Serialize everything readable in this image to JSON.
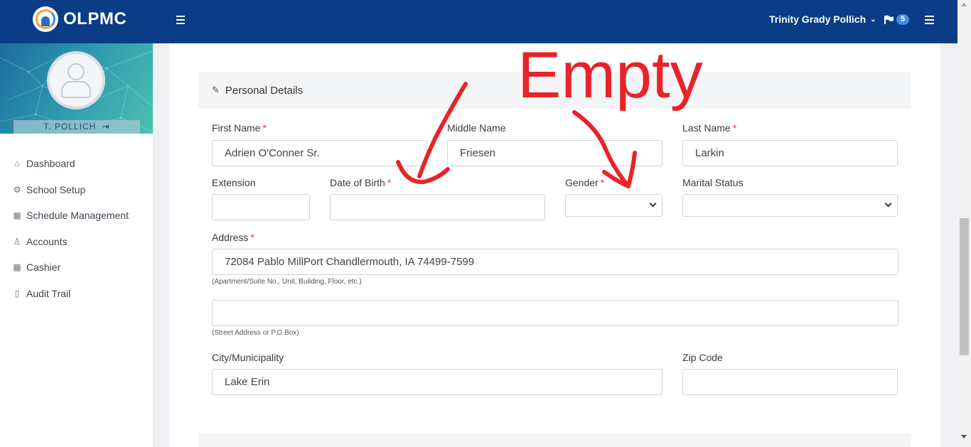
{
  "app": {
    "brand": "OLPMC"
  },
  "header": {
    "user_name": "Trinity Grady Pollich",
    "notification_count": "5"
  },
  "sidebar": {
    "profile_name": "T. POLLICH",
    "items": [
      {
        "label": "Dashboard",
        "icon": "home-icon"
      },
      {
        "label": "School Setup",
        "icon": "gear-icon"
      },
      {
        "label": "Schedule Management",
        "icon": "calendar-icon"
      },
      {
        "label": "Accounts",
        "icon": "users-icon"
      },
      {
        "label": "Cashier",
        "icon": "calculator-icon"
      },
      {
        "label": "Audit Trail",
        "icon": "book-icon"
      }
    ]
  },
  "form": {
    "section_title": "Personal Details",
    "required_mark": "*",
    "first_name": {
      "label": "First Name",
      "value": "Adrien O'Conner Sr."
    },
    "middle_name": {
      "label": "Middle Name",
      "value": "Friesen"
    },
    "last_name": {
      "label": "Last Name",
      "value": "Larkin"
    },
    "extension": {
      "label": "Extension",
      "value": ""
    },
    "date_of_birth": {
      "label": "Date of Birth",
      "value": ""
    },
    "gender": {
      "label": "Gender",
      "value": ""
    },
    "marital_status": {
      "label": "Marital Status",
      "value": ""
    },
    "address": {
      "label": "Address",
      "line1": "72084 Pablo MillPort Chandlermouth, IA 74499-7599",
      "line1_hint": "(Apartment/Suite No., Unit, Building, Floor, etc.)",
      "line2": "",
      "line2_hint": "(Street Address or P.O.Box)"
    },
    "city": {
      "label": "City/Municipality",
      "value": "Lake Erin"
    },
    "zip_code": {
      "label": "Zip Code",
      "value": ""
    }
  },
  "annotation": {
    "text": "Empty",
    "color": "#e8232a"
  }
}
